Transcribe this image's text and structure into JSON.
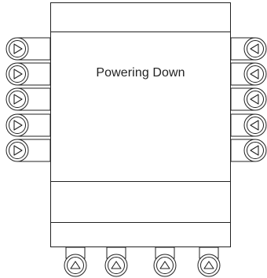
{
  "display": {
    "status_message": "Powering Down"
  },
  "keys": {
    "left_count": 5,
    "right_count": 5,
    "bottom_count": 4,
    "left_icon": "right-arrow-icon",
    "right_icon": "left-arrow-icon",
    "bottom_icon": "up-arrow-icon"
  },
  "colors": {
    "outline": "#222222",
    "background": "#ffffff"
  }
}
